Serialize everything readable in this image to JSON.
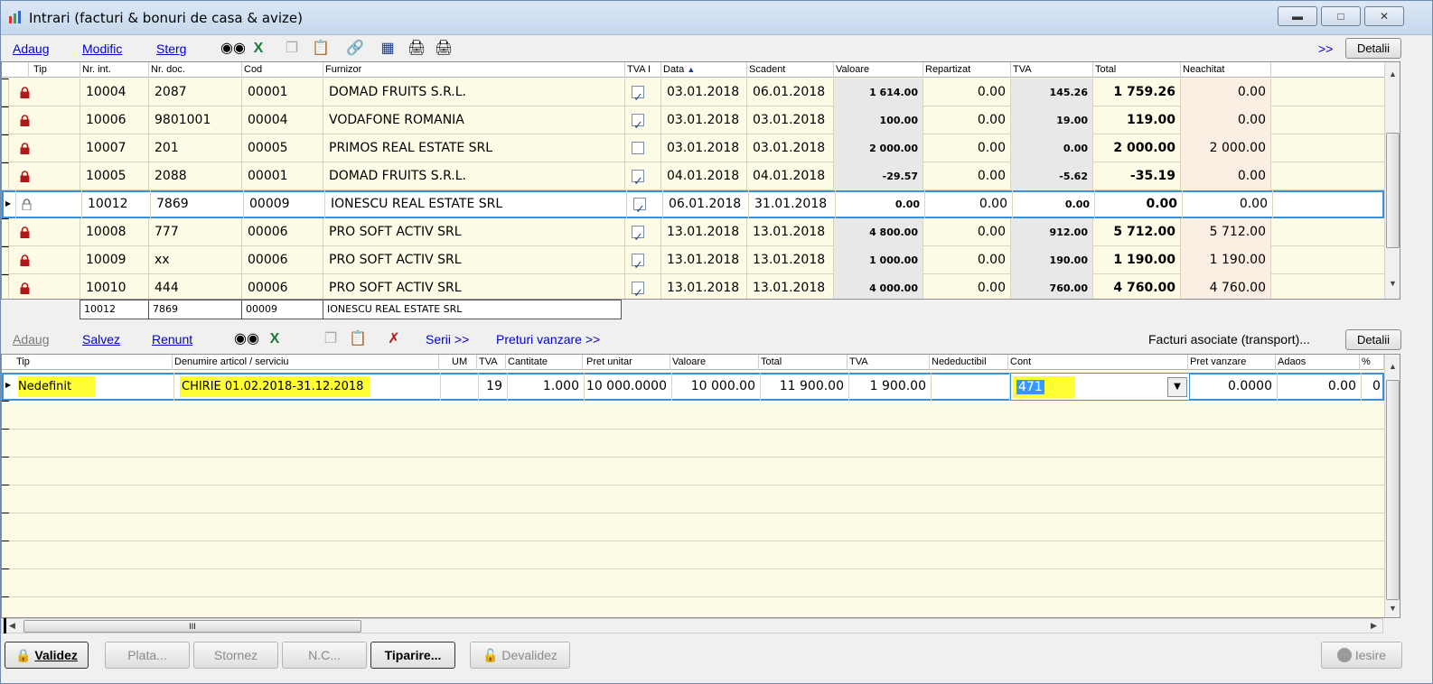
{
  "window": {
    "title": "Intrari (facturi & bonuri de casa & avize)"
  },
  "toolbar1": {
    "adaug": "Adaug",
    "modific": "Modific",
    "sterg": "Sterg",
    "more": ">>",
    "detalii": "Detalii"
  },
  "top_grid": {
    "columns": [
      "Tip",
      "Nr. int.",
      "Nr. doc.",
      "Cod",
      "Furnizor",
      "TVA I",
      "Data",
      "Scadent",
      "Valoare",
      "Repartizat",
      "TVA",
      "Total",
      "Neachitat"
    ],
    "rows": [
      {
        "nr_int": "10004",
        "nr_doc": "2087",
        "cod": "00001",
        "furnizor": "DOMAD FRUITS S.R.L.",
        "tva_i": true,
        "data": "03.01.2018",
        "scadent": "06.01.2018",
        "valoare": "1 614.00",
        "repartizat": "0.00",
        "tva": "145.26",
        "total": "1 759.26",
        "neachitat": "0.00"
      },
      {
        "nr_int": "10006",
        "nr_doc": "9801001",
        "cod": "00004",
        "furnizor": "VODAFONE ROMANIA",
        "tva_i": true,
        "data": "03.01.2018",
        "scadent": "03.01.2018",
        "valoare": "100.00",
        "repartizat": "0.00",
        "tva": "19.00",
        "total": "119.00",
        "neachitat": "0.00"
      },
      {
        "nr_int": "10007",
        "nr_doc": "201",
        "cod": "00005",
        "furnizor": "PRIMOS REAL ESTATE SRL",
        "tva_i": false,
        "data": "03.01.2018",
        "scadent": "03.01.2018",
        "valoare": "2 000.00",
        "repartizat": "0.00",
        "tva": "0.00",
        "total": "2 000.00",
        "neachitat": "2 000.00"
      },
      {
        "nr_int": "10005",
        "nr_doc": "2088",
        "cod": "00001",
        "furnizor": "DOMAD FRUITS S.R.L.",
        "tva_i": true,
        "data": "04.01.2018",
        "scadent": "04.01.2018",
        "valoare": "-29.57",
        "repartizat": "0.00",
        "tva": "-5.62",
        "total": "-35.19",
        "neachitat": "0.00"
      },
      {
        "nr_int": "10012",
        "nr_doc": "7869",
        "cod": "00009",
        "furnizor": "IONESCU REAL ESTATE SRL",
        "tva_i": true,
        "data": "06.01.2018",
        "scadent": "31.01.2018",
        "valoare": "0.00",
        "repartizat": "0.00",
        "tva": "0.00",
        "total": "0.00",
        "neachitat": "0.00",
        "selected": true
      },
      {
        "nr_int": "10008",
        "nr_doc": "777",
        "cod": "00006",
        "furnizor": "PRO SOFT ACTIV SRL",
        "tva_i": true,
        "data": "13.01.2018",
        "scadent": "13.01.2018",
        "valoare": "4 800.00",
        "repartizat": "0.00",
        "tva": "912.00",
        "total": "5 712.00",
        "neachitat": "5 712.00"
      },
      {
        "nr_int": "10009",
        "nr_doc": "xx",
        "cod": "00006",
        "furnizor": "PRO SOFT ACTIV SRL",
        "tva_i": true,
        "data": "13.01.2018",
        "scadent": "13.01.2018",
        "valoare": "1 000.00",
        "repartizat": "0.00",
        "tva": "190.00",
        "total": "1 190.00",
        "neachitat": "1 190.00"
      },
      {
        "nr_int": "10010",
        "nr_doc": "444",
        "cod": "00006",
        "furnizor": "PRO SOFT ACTIV SRL",
        "tva_i": true,
        "data": "13.01.2018",
        "scadent": "13.01.2018",
        "valoare": "4 000.00",
        "repartizat": "0.00",
        "tva": "760.00",
        "total": "4 760.00",
        "neachitat": "4 760.00"
      }
    ],
    "footer": {
      "nr_int": "10012",
      "nr_doc": "7869",
      "cod": "00009",
      "furnizor": "IONESCU REAL ESTATE SRL"
    }
  },
  "toolbar2": {
    "adaug": "Adaug",
    "salvez": "Salvez",
    "renunt": "Renunt",
    "serii": "Serii >>",
    "preturi": "Preturi vanzare >>",
    "facturi_asociate": "Facturi asociate (transport)...",
    "detalii": "Detalii"
  },
  "bottom_grid": {
    "columns": [
      "Tip",
      "Denumire articol / serviciu",
      "UM",
      "TVA",
      "Cantitate",
      "Pret unitar",
      "Valoare",
      "Total",
      "TVA",
      "Nedeductibil",
      "Cont",
      "Pret vanzare",
      "Adaos",
      "%"
    ],
    "row": {
      "tip": "Nedefinit",
      "denumire": "CHIRIE 01.02.2018-31.12.2018",
      "um": "",
      "tva": "19",
      "cantitate": "1.000",
      "pret_unitar": "10 000.0000",
      "valoare": "10 000.00",
      "total": "11 900.00",
      "tva_val": "1 900.00",
      "nedeductibil": "",
      "cont": "471",
      "pret_vanzare": "0.0000",
      "adaos": "0.00",
      "pct": "0"
    }
  },
  "hscroll": {
    "thumb_glyph": "III"
  },
  "buttons": {
    "validez": "Validez",
    "plata": "Plata...",
    "stornez": "Stornez",
    "nc": "N.C...",
    "tiparire": "Tiparire...",
    "devalidez": "Devalidez",
    "iesire": "Iesire"
  },
  "colors": {
    "highlight": "#ffff33",
    "selected_border": "#3c8fdb",
    "grid_bg": "#fdfbe6",
    "lock_red": "#b01818"
  }
}
